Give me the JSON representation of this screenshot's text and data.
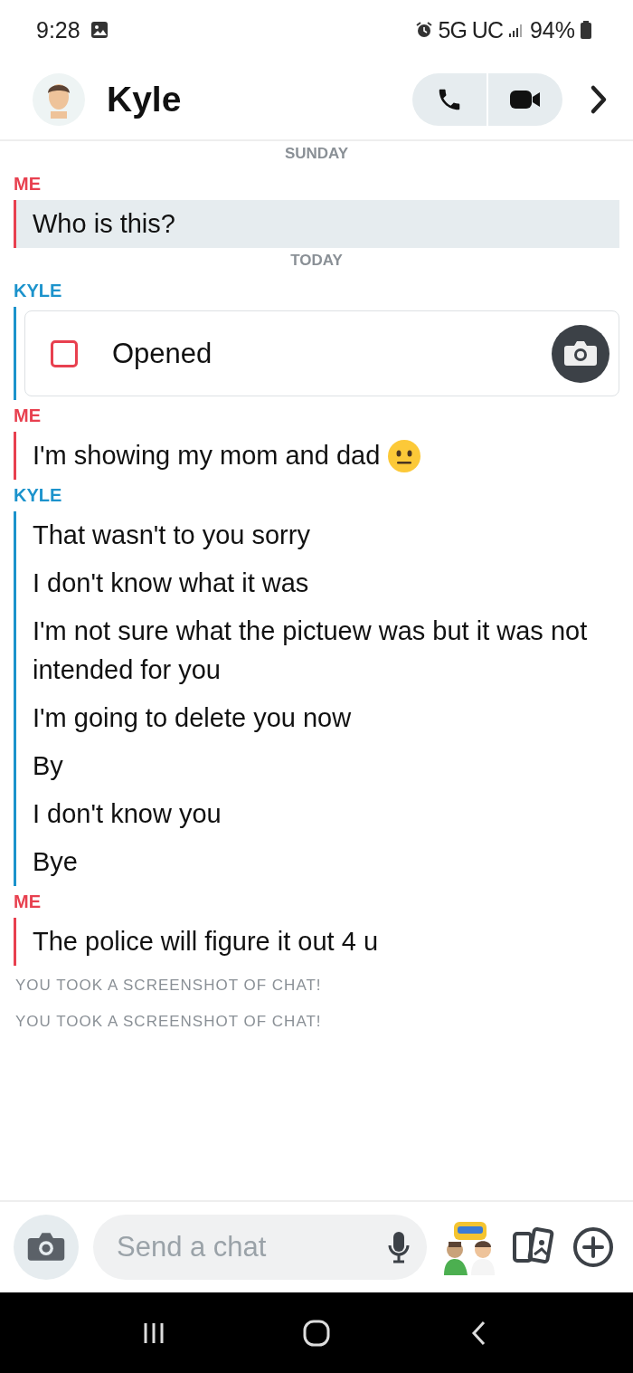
{
  "status_bar": {
    "time": "9:28",
    "network": "5G UC",
    "battery": "94%"
  },
  "header": {
    "name": "Kyle"
  },
  "chat": [
    {
      "kind": "date",
      "label": "SUNDAY"
    },
    {
      "kind": "group",
      "sender": "ME",
      "color": "#e8404f",
      "messages": [
        {
          "kind": "text",
          "text": "Who is this?",
          "saved": true
        }
      ]
    },
    {
      "kind": "date",
      "label": "TODAY"
    },
    {
      "kind": "group",
      "sender": "KYLE",
      "color": "#1c93cc",
      "messages": [
        {
          "kind": "snap",
          "text": "Opened"
        }
      ]
    },
    {
      "kind": "group",
      "sender": "ME",
      "color": "#e8404f",
      "messages": [
        {
          "kind": "text",
          "text": "I'm showing my mom and dad",
          "saved": false,
          "emoji": true
        }
      ]
    },
    {
      "kind": "group",
      "sender": "KYLE",
      "color": "#1c93cc",
      "messages": [
        {
          "kind": "text",
          "text": "That wasn't to you sorry",
          "saved": false
        },
        {
          "kind": "text",
          "text": "I don't know what it was",
          "saved": false
        },
        {
          "kind": "text",
          "text": "I'm not sure what the pictuew was but it was not intended for you",
          "saved": false
        },
        {
          "kind": "text",
          "text": "I'm going to delete you now",
          "saved": false
        },
        {
          "kind": "text",
          "text": "By",
          "saved": false
        },
        {
          "kind": "text",
          "text": "I don't know you",
          "saved": false
        },
        {
          "kind": "text",
          "text": "Bye",
          "saved": false
        }
      ]
    },
    {
      "kind": "group",
      "sender": "ME",
      "color": "#e8404f",
      "messages": [
        {
          "kind": "text",
          "text": "The police will figure it out 4 u",
          "saved": false
        }
      ]
    },
    {
      "kind": "notice",
      "label": "YOU TOOK A SCREENSHOT OF CHAT!"
    },
    {
      "kind": "notice",
      "label": "YOU TOOK A SCREENSHOT OF CHAT!"
    }
  ],
  "composer": {
    "placeholder": "Send a chat"
  }
}
